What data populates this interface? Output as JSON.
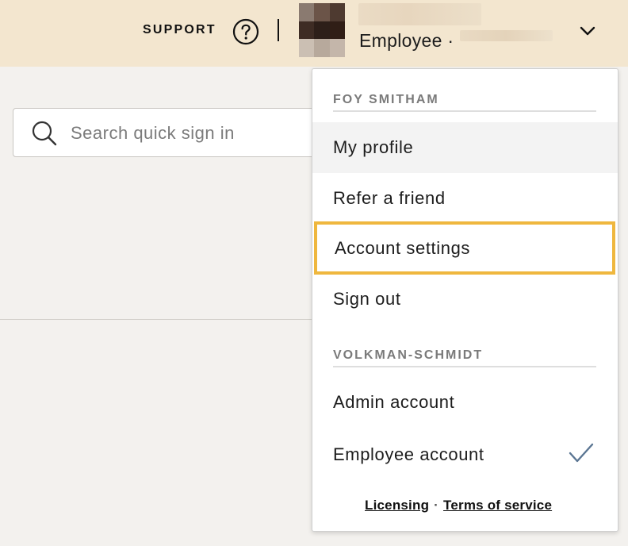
{
  "header": {
    "support_label": "SUPPORT",
    "role_label": "Employee ·",
    "help_icon": "question-circle-icon",
    "menu_toggle_icon": "chevron-down-icon",
    "background_color": "#f3e6cf"
  },
  "search": {
    "placeholder": "Search quick sign in",
    "value": "",
    "icon": "search-icon"
  },
  "dropdown": {
    "user_section_title": "FOY SMITHAM",
    "user_items": [
      {
        "label": "My profile"
      },
      {
        "label": "Refer a friend"
      },
      {
        "label": "Account settings"
      },
      {
        "label": "Sign out"
      }
    ],
    "org_section_title": "VOLKMAN-SCHMIDT",
    "org_items": [
      {
        "label": "Admin account"
      },
      {
        "label": "Employee account",
        "selected": true
      }
    ],
    "selected_icon": "checkmark-icon",
    "footer": {
      "licensing_label": "Licensing",
      "separator": "·",
      "terms_label": "Terms of service"
    },
    "hover_color": "#f3f3f3",
    "focus_color": "#efb73e",
    "check_color": "#5b7693"
  }
}
